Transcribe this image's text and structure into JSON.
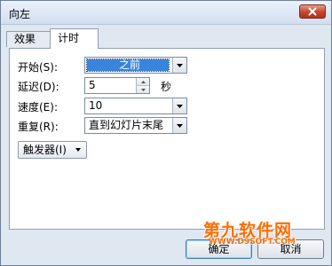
{
  "window": {
    "title": "向左"
  },
  "tabs": [
    {
      "label": "效果"
    },
    {
      "label": "计时"
    }
  ],
  "timing": {
    "start_label": "开始(S):",
    "start_value": "之前",
    "delay_label": "延迟(D):",
    "delay_value": "5",
    "delay_unit": "秒",
    "speed_label": "速度(E):",
    "speed_value": "10",
    "repeat_label": "重复(R):",
    "repeat_value": "直到幻灯片末尾",
    "trigger_label": "触发器(I)"
  },
  "buttons": {
    "ok": "确定",
    "cancel": "取消"
  },
  "watermark": {
    "main": "第九软件网",
    "sub": "WWW.D9SOFT.COM"
  },
  "colors": {
    "selection": "#3a85db",
    "close": "#c54529",
    "watermark": "#ff6c00"
  },
  "icons": {
    "close": "close-icon",
    "dropdown": "chevron-down-icon",
    "spin_up": "up-arrow-icon",
    "spin_down": "down-arrow-icon"
  }
}
